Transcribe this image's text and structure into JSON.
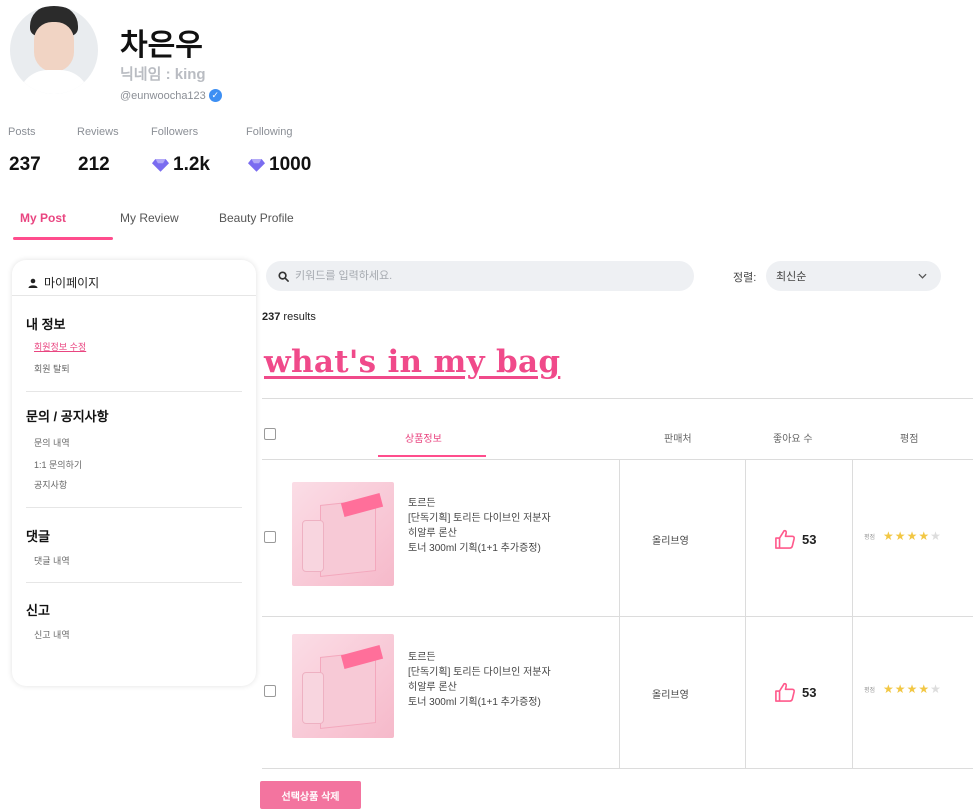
{
  "profile": {
    "name": "차은우",
    "nickname": "닉네임 : king",
    "handle": "@eunwoocha123",
    "stats": [
      {
        "label": "Posts",
        "value": "237"
      },
      {
        "label": "Reviews",
        "value": "212"
      },
      {
        "label": "Followers",
        "value": "1.2k"
      },
      {
        "label": "Following",
        "value": "1000"
      }
    ]
  },
  "tabs": [
    "My Post",
    "My Review",
    "Beauty Profile"
  ],
  "sidebar": {
    "header": "마이페이지",
    "sections": [
      {
        "title": "내 정보",
        "items": [
          "회원정보 수정",
          "회원 탈퇴"
        ]
      },
      {
        "title": "문의 / 공지사항",
        "items": [
          "문의 내역",
          "1:1 문의하기",
          "공지사항"
        ]
      },
      {
        "title": "댓글",
        "items": [
          "댓글 내역"
        ]
      },
      {
        "title": "신고",
        "items": [
          "신고 내역"
        ]
      }
    ]
  },
  "search": {
    "placeholder": "키워드를 입력하세요."
  },
  "sort": {
    "label": "정렬:",
    "selected": "최신순"
  },
  "results": {
    "count": "237",
    "suffix": " results"
  },
  "bag_title": "what's in my bag",
  "table": {
    "headers": [
      "상품정보",
      "판매처",
      "좋아요 수",
      "평점"
    ],
    "rows": [
      {
        "brand": "토르든",
        "line1": "[단독기획] 토리든 다이브인 저분자",
        "line2": "히알루 론산",
        "line3": "토너 300ml 기획(1+1 추가증정)",
        "seller": "올리브영",
        "likes": "53",
        "rating_label": "평점",
        "stars": 4
      },
      {
        "brand": "토르든",
        "line1": "[단독기획] 토리든 다이브인 저분자",
        "line2": "히알루 론산",
        "line3": "토너 300ml 기획(1+1 추가증정)",
        "seller": "올리브영",
        "likes": "53",
        "rating_label": "평점",
        "stars": 4
      }
    ]
  },
  "delete_button": "선택상품 삭제",
  "colors": {
    "accent": "#ff4d8d",
    "verified": "#3d8ff3",
    "gem": "#7a6cf0",
    "star": "#f2c744"
  }
}
